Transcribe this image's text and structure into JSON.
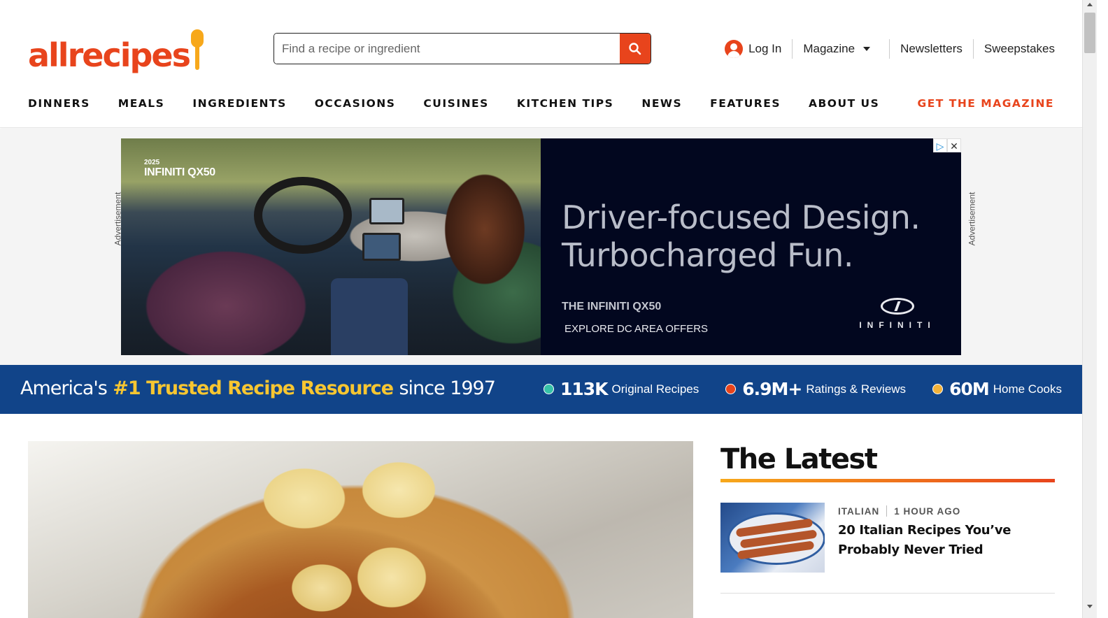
{
  "header": {
    "logo_text": "allrecipes",
    "search": {
      "placeholder": "Find a recipe or ingredient",
      "value": ""
    },
    "utility": {
      "login": "Log In",
      "magazine": "Magazine",
      "newsletters": "Newsletters",
      "sweepstakes": "Sweepstakes"
    },
    "nav": [
      "DINNERS",
      "MEALS",
      "INGREDIENTS",
      "OCCASIONS",
      "CUISINES",
      "KITCHEN TIPS",
      "NEWS",
      "FEATURES",
      "ABOUT US"
    ],
    "nav_cta": "GET THE MAGAZINE"
  },
  "ad": {
    "label": "Advertisement",
    "brand_year": "2025",
    "brand_model": "INFINITI QX50",
    "headline_line1": "Driver-focused Design.",
    "headline_line2": "Turbocharged Fun.",
    "sub1": "THE INFINITI QX50",
    "sub2": "EXPLORE DC AREA OFFERS",
    "logo_word": "INFINITI",
    "adchoices_icon": "▷",
    "close_icon": "✕"
  },
  "trust": {
    "prefix": "America's",
    "highlight": "#1 Trusted Recipe Resource",
    "suffix": "since 1997",
    "stats": [
      {
        "num": "113K",
        "label": "Original Recipes",
        "color": "#36c2a8"
      },
      {
        "num": "6.9M+",
        "label": "Ratings & Reviews",
        "color": "#e8441c"
      },
      {
        "num": "60M",
        "label": "Home Cooks",
        "color": "#f2b23a"
      }
    ]
  },
  "latest": {
    "title": "The Latest",
    "cards": [
      {
        "category": "ITALIAN",
        "time": "1 HOUR AGO",
        "title": "20 Italian Recipes You’ve Probably Never Tried"
      }
    ]
  },
  "colors": {
    "brand": "#e8441c",
    "brand_yellow": "#f7a81b",
    "trust_band": "#114489",
    "trust_highlight": "#f7c631"
  }
}
